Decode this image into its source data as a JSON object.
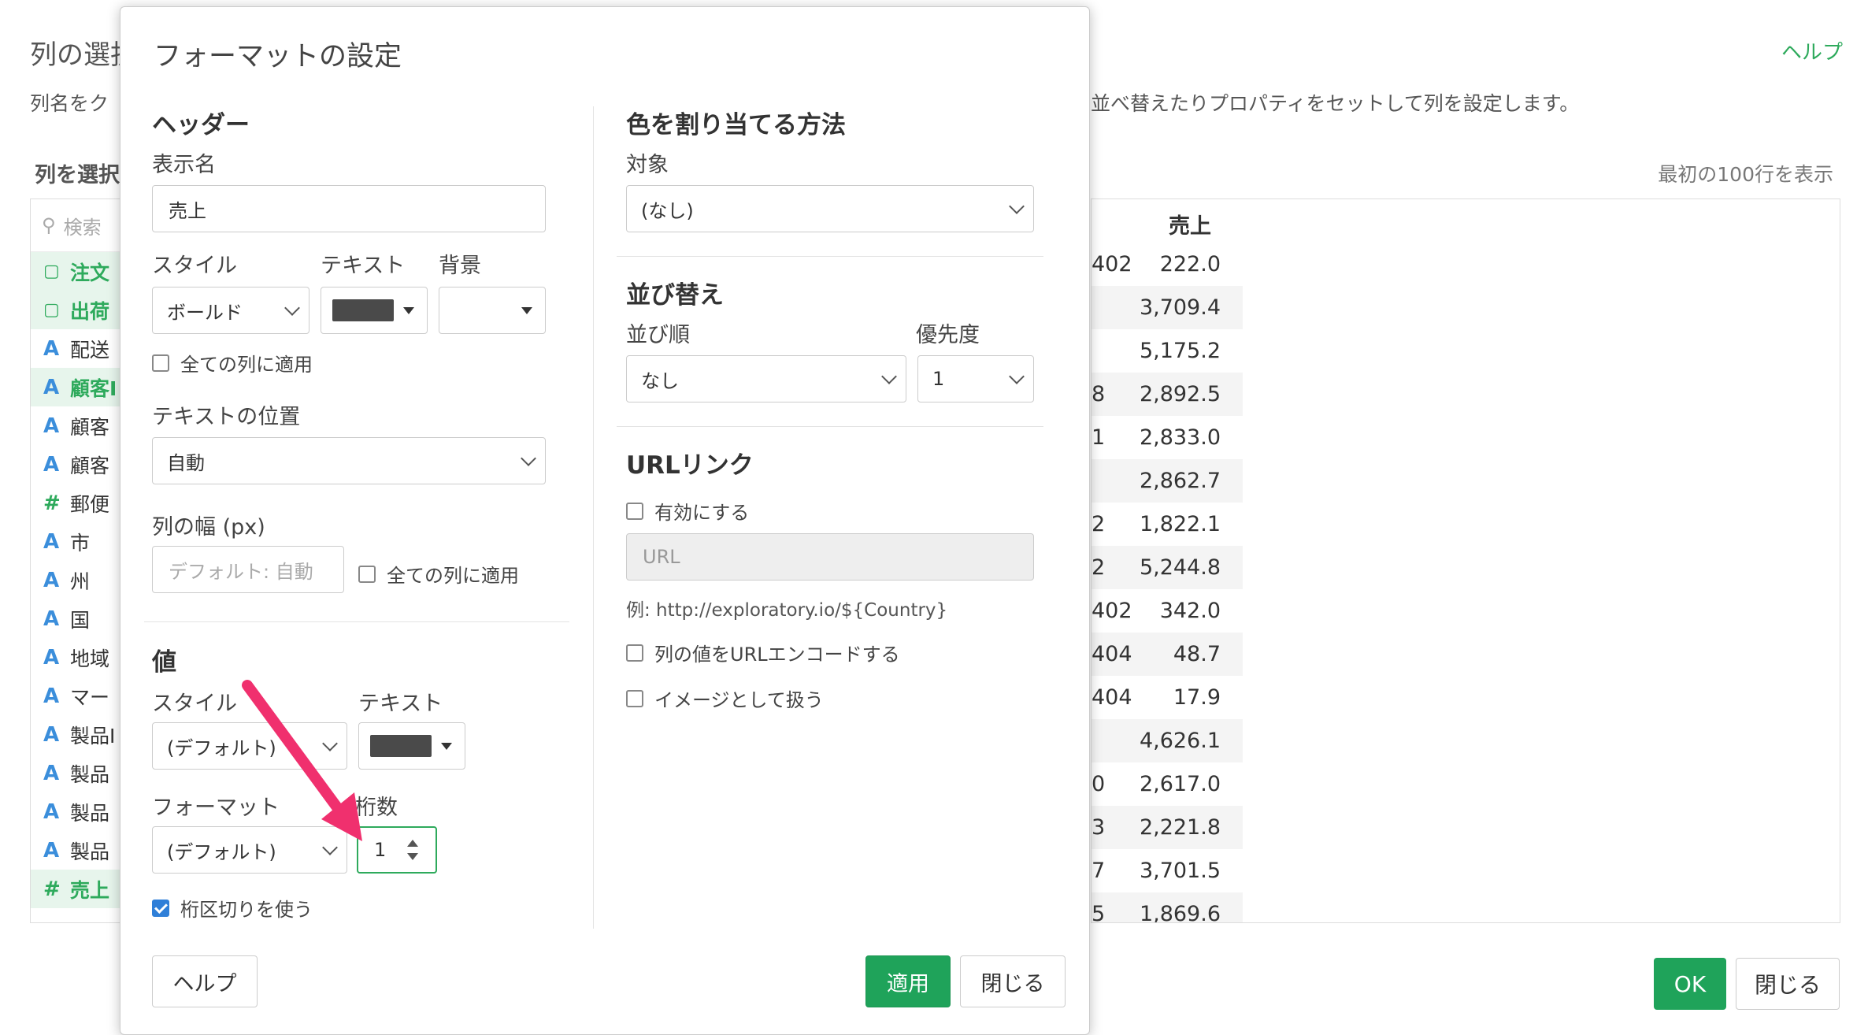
{
  "background": {
    "title": "列の選択",
    "help_link": "ヘルプ",
    "description_left": "列名をク",
    "description_right": "並べ替えたりプロパティをセットして列を設定します。",
    "select_columns_label": "列を選択",
    "first_rows_label": "最初の100行を表示",
    "search_placeholder": "検索",
    "columns": [
      {
        "type": "date",
        "icon": "calendar-icon",
        "label": "注文",
        "selected": true
      },
      {
        "type": "date",
        "icon": "calendar-icon",
        "label": "出荷",
        "selected": true
      },
      {
        "type": "text",
        "icon": "text-type-icon",
        "label": "配送",
        "selected": false
      },
      {
        "type": "text",
        "icon": "text-type-icon",
        "label": "顧客I",
        "selected": true
      },
      {
        "type": "text",
        "icon": "text-type-icon",
        "label": "顧客",
        "selected": false
      },
      {
        "type": "text",
        "icon": "text-type-icon",
        "label": "顧客",
        "selected": false
      },
      {
        "type": "number",
        "icon": "hash-icon",
        "label": "郵便",
        "selected": false
      },
      {
        "type": "text",
        "icon": "text-type-icon",
        "label": "市",
        "selected": false
      },
      {
        "type": "text",
        "icon": "text-type-icon",
        "label": "州",
        "selected": false
      },
      {
        "type": "text",
        "icon": "text-type-icon",
        "label": "国",
        "selected": false
      },
      {
        "type": "text",
        "icon": "text-type-icon",
        "label": "地域",
        "selected": false
      },
      {
        "type": "text",
        "icon": "text-type-icon",
        "label": "マー",
        "selected": false
      },
      {
        "type": "text",
        "icon": "text-type-icon",
        "label": "製品I",
        "selected": false
      },
      {
        "type": "text",
        "icon": "text-type-icon",
        "label": "製品",
        "selected": false
      },
      {
        "type": "text",
        "icon": "text-type-icon",
        "label": "製品",
        "selected": false
      },
      {
        "type": "text",
        "icon": "text-type-icon",
        "label": "製品",
        "selected": false
      },
      {
        "type": "number",
        "icon": "hash-icon",
        "label": "売上",
        "selected": true
      }
    ],
    "table": {
      "header": "売上",
      "rows": [
        {
          "c1": "402",
          "c2": "222.0"
        },
        {
          "c1": "",
          "c2": "3,709.4"
        },
        {
          "c1": "",
          "c2": "5,175.2"
        },
        {
          "c1": "8",
          "c2": "2,892.5"
        },
        {
          "c1": "1",
          "c2": "2,833.0"
        },
        {
          "c1": "",
          "c2": "2,862.7"
        },
        {
          "c1": "2",
          "c2": "1,822.1"
        },
        {
          "c1": "2",
          "c2": "5,244.8"
        },
        {
          "c1": "402",
          "c2": "342.0"
        },
        {
          "c1": "404",
          "c2": "48.7"
        },
        {
          "c1": "404",
          "c2": "17.9"
        },
        {
          "c1": "",
          "c2": "4,626.1"
        },
        {
          "c1": "0",
          "c2": "2,617.0"
        },
        {
          "c1": "3",
          "c2": "2,221.8"
        },
        {
          "c1": "7",
          "c2": "3,701.5"
        },
        {
          "c1": "5",
          "c2": "1,869.6"
        }
      ]
    },
    "ok_button": "OK",
    "close_button": "閉じる"
  },
  "dialog": {
    "title": "フォーマットの設定",
    "header_section": {
      "title": "ヘッダー",
      "display_name_label": "表示名",
      "display_name_value": "売上",
      "style_label": "スタイル",
      "style_value": "ボールド",
      "text_label": "テキスト",
      "text_color": "#4a4a4a",
      "background_label": "背景",
      "apply_all_label": "全ての列に適用",
      "apply_all_checked": false,
      "text_position_label": "テキストの位置",
      "text_position_value": "自動",
      "column_width_label": "列の幅 (px)",
      "column_width_placeholder": "デフォルト: 自動",
      "width_apply_all_label": "全ての列に適用",
      "width_apply_all_checked": false
    },
    "value_section": {
      "title": "値",
      "style_label": "スタイル",
      "style_value": "(デフォルト)",
      "text_label": "テキスト",
      "text_color": "#4a4a4a",
      "format_label": "フォーマット",
      "format_value": "(デフォルト)",
      "digits_label": "桁数",
      "digits_value": "1",
      "separator_label": "桁区切りを使う",
      "separator_checked": true
    },
    "color_section": {
      "title": "色を割り当てる方法",
      "target_label": "対象",
      "target_value": "(なし)"
    },
    "sort_section": {
      "title": "並び替え",
      "order_label": "並び順",
      "order_value": "なし",
      "priority_label": "優先度",
      "priority_value": "1"
    },
    "url_section": {
      "title": "URLリンク",
      "enable_label": "有効にする",
      "enable_checked": false,
      "url_placeholder": "URL",
      "example_text": "例: http://exploratory.io/${Country}",
      "encode_label": "列の値をURLエンコードする",
      "encode_checked": false,
      "image_label": "イメージとして扱う",
      "image_checked": false
    },
    "help_button": "ヘルプ",
    "apply_button": "適用",
    "close_button": "閉じる"
  },
  "colors": {
    "accent_green": "#1fa35a",
    "annotation_arrow": "#f0306e",
    "checkbox_blue": "#2f7fd8"
  }
}
